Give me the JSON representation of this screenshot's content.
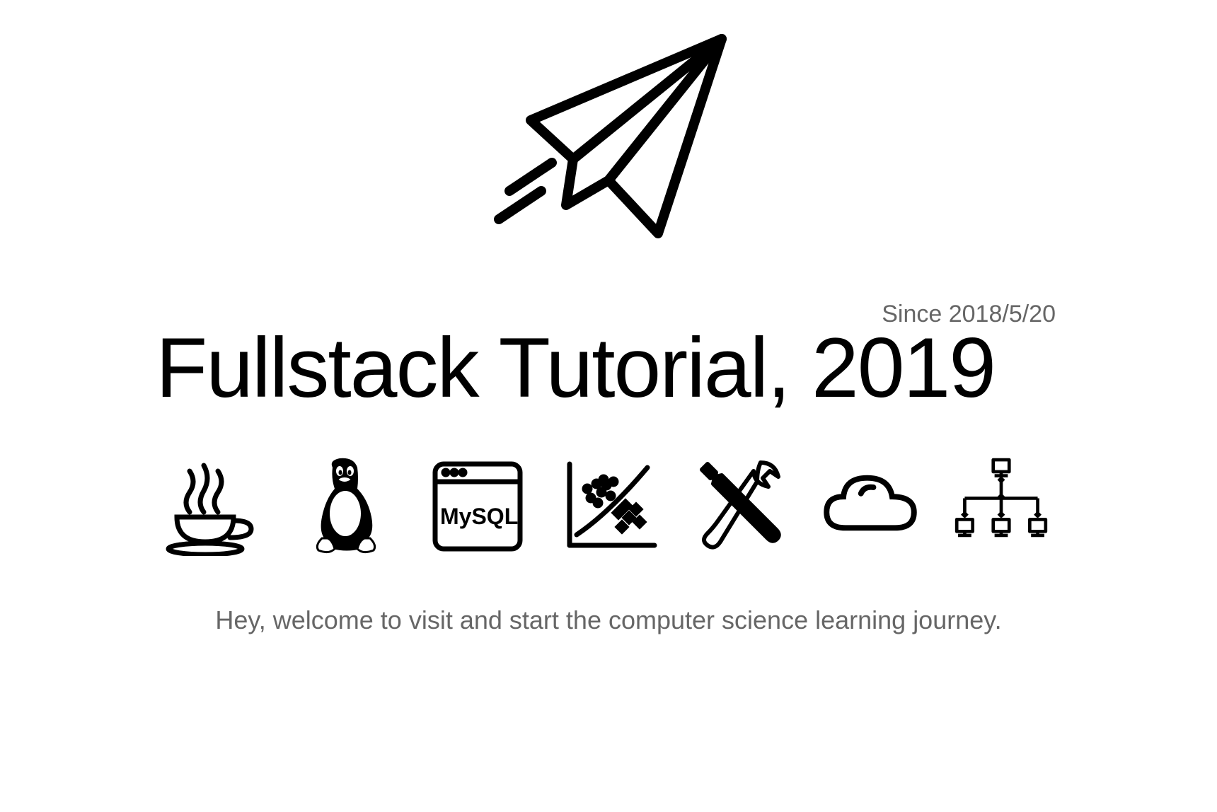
{
  "since": "Since 2018/5/20",
  "title": "Fullstack Tutorial, 2019",
  "welcome": "Hey, welcome to visit and start the computer science learning journey.",
  "icons": {
    "hero": "paper-plane",
    "tech": [
      "java-coffee",
      "linux-penguin",
      "mysql",
      "data-plot",
      "tools",
      "cloud",
      "network-topology"
    ]
  },
  "mysql_label": "MySQL"
}
